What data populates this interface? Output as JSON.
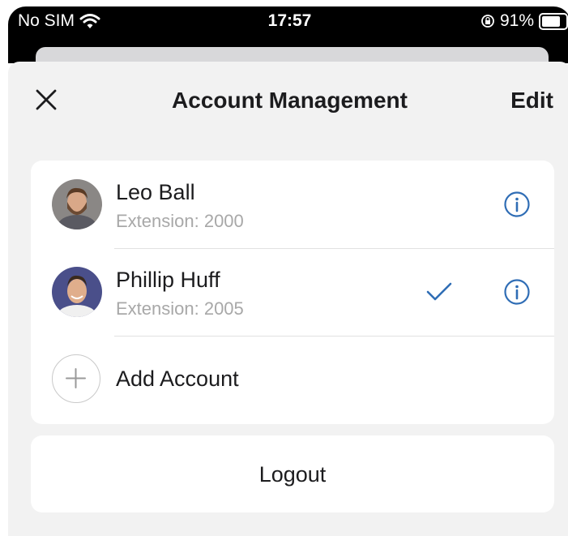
{
  "status_bar": {
    "carrier": "No SIM",
    "time": "17:57",
    "battery": "91%",
    "battery_level": 0.91,
    "icons": [
      "wifi-icon",
      "orientation-lock-icon",
      "battery-icon"
    ]
  },
  "header": {
    "title": "Account Management",
    "edit_label": "Edit",
    "close_icon": "close-icon"
  },
  "accounts": [
    {
      "name": "Leo Ball",
      "extension": "Extension: 2000",
      "selected": false
    },
    {
      "name": "Phillip Huff",
      "extension": "Extension: 2005",
      "selected": true
    }
  ],
  "add_account_label": "Add Account",
  "logout_label": "Logout",
  "colors": {
    "accent": "#2f6db5",
    "sheet_bg": "#f2f2f2",
    "card_bg": "#ffffff",
    "secondary_text": "#a8a8a8"
  }
}
